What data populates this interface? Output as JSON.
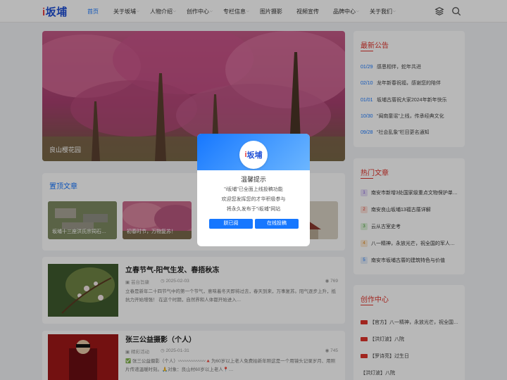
{
  "header": {
    "logo_prefix": "i",
    "logo_text": "坂埔",
    "nav": [
      {
        "label": "首页",
        "active": true,
        "dropdown": false
      },
      {
        "label": "关于坂埔",
        "active": false,
        "dropdown": true
      },
      {
        "label": "人物介绍",
        "active": false,
        "dropdown": true
      },
      {
        "label": "创作中心",
        "active": false,
        "dropdown": true
      },
      {
        "label": "专栏信息",
        "active": false,
        "dropdown": true
      },
      {
        "label": "图片摄影",
        "active": false,
        "dropdown": false
      },
      {
        "label": "视频宣传",
        "active": false,
        "dropdown": false
      },
      {
        "label": "品牌中心",
        "active": false,
        "dropdown": true
      },
      {
        "label": "关于我们",
        "active": false,
        "dropdown": true
      }
    ],
    "icons": [
      "layers-icon",
      "search-icon"
    ]
  },
  "hero": {
    "caption": "良山樱花园"
  },
  "pinned": {
    "title": "置顶文章",
    "items": [
      {
        "caption": "坂埔十三座洪氏宗祠石…"
      },
      {
        "caption": "初春时节，万物复苏！"
      },
      {
        "caption": ""
      },
      {
        "caption": ""
      }
    ]
  },
  "articles": [
    {
      "title": "立春节气-阳气生发、春捂秋冻",
      "category": "芸台旨康",
      "date": "2025-02-03",
      "views": "769",
      "excerpt": "立春是新年二十四节气中的第一个节气，意味着冬天即将过去，春天到来，万事复苏。阳气逐步上升，抵抗力开始增强！ 在这个时期，自然界和人体都开始进入…"
    },
    {
      "title": "张三公益摄影（个人）",
      "category": "精彩活动",
      "date": "2025-01-31",
      "views": "745",
      "excerpt": "✅ 张三公益摄影（个人）〰〰〰〰〰〰🔺为60岁以上老人免费拍新年照这是一个用镜头记录岁月、用照片传递温暖时刻。🙏对象：良山村60岁以上老人📍…"
    }
  ],
  "sidebar": {
    "notice": {
      "title": "最新公告",
      "items": [
        {
          "date": "01/29",
          "text": "感恩相伴，蛇年共进"
        },
        {
          "date": "02/10",
          "text": "龙年新春祝福，感谢您的陪伴"
        },
        {
          "date": "01/01",
          "text": "坂埔古厝祝大家2024年新年快乐"
        },
        {
          "date": "10/30",
          "text": "“闽南童谣”上线，传承经典文化"
        },
        {
          "date": "09/28",
          "text": "“社会乱象”栏目更名通知"
        }
      ]
    },
    "hot": {
      "title": "热门文章",
      "items": [
        {
          "num": "1",
          "text": "南安市新增3处国家级重点文物保护单…"
        },
        {
          "num": "2",
          "text": "南安良山坂埔13福古厝详解"
        },
        {
          "num": "3",
          "text": "云从古室史考"
        },
        {
          "num": "4",
          "text": "八一精神，永放光芒，祝全国的军人…"
        },
        {
          "num": "5",
          "text": "南安市坂埔古厝的建筑特色与价值"
        }
      ]
    },
    "create": {
      "title": "创作中心",
      "items": [
        {
          "text": "【官方】八一精神，永放光芒，祝全国…"
        },
        {
          "text": "【洪灯波】八院"
        },
        {
          "text": "【罗诗亮】过生日"
        },
        {
          "text": "【洪灯波】八院"
        }
      ]
    }
  },
  "modal": {
    "logo_prefix": "i",
    "logo_text": "坂埔",
    "title": "温馨提示",
    "lines": [
      "\"i坂埔\"已全面上线投稿功能",
      "欢迎您发挥您的才华积极参与",
      "将永久发布于\"i坂埔\"网站"
    ],
    "btn_known": "朕已阅",
    "btn_submit": "在线投稿"
  },
  "colors": {
    "accent": "#1677ff",
    "sidebar_title": "#e0342b"
  }
}
